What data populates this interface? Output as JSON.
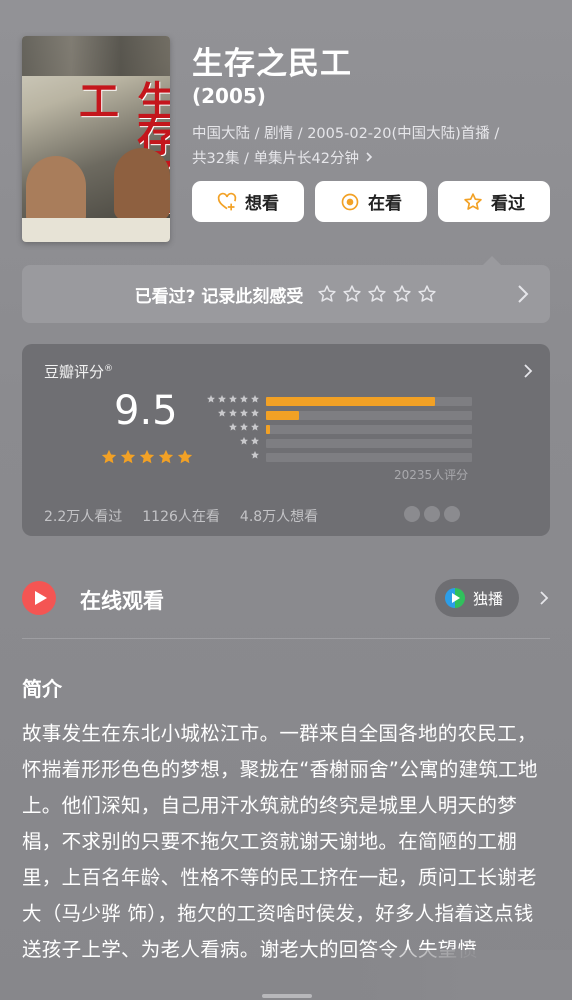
{
  "movie": {
    "title": "生存之民工",
    "year": "(2005)",
    "meta_line1": "中国大陆 / 剧情 / 2005-02-20(中国大陆)首播 /",
    "meta_line2": "共32集 / 单集片长42分钟",
    "poster_title": "生存之民工"
  },
  "actions": {
    "want": "想看",
    "watching": "在看",
    "watched": "看过"
  },
  "record": {
    "prompt": "已看过? 记录此刻感受"
  },
  "rating": {
    "source": "豆瓣评分",
    "score": "9.5",
    "star_fill": 5,
    "distribution_percent": [
      82,
      16,
      2,
      0,
      0
    ],
    "count": "20235人评分",
    "watched": "2.2万人看过",
    "watching": "1126人在看",
    "want": "4.8万人想看"
  },
  "online": {
    "label": "在线观看",
    "badge": "独播"
  },
  "intro": {
    "heading": "简介",
    "text": "故事发生在东北小城松江市。一群来自全国各地的农民工，怀揣着形形色色的梦想，聚拢在“香榭丽舍”公寓的建筑工地上。他们深知，自己用汗水筑就的终究是城里人明天的梦椙，不求别的只要不拖欠工资就谢天谢地。在简陋的工棚里，上百名年龄、性格不等的民工挤在一起，质问工长谢老大（马少骅 饰），拖欠的工资啥时侯发，好多人指着这点钱送孩子上学、为老人看病。谢老大的回答令人失望愤"
  },
  "colors": {
    "accent_orange": "#f2a125",
    "play_red": "#f45553",
    "card_bg": "#6f6f73"
  }
}
